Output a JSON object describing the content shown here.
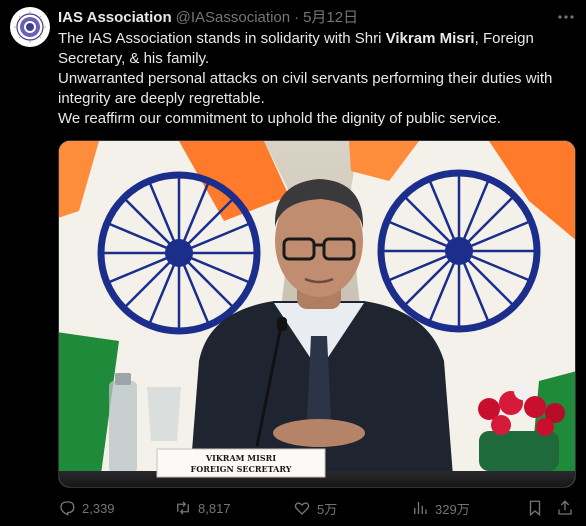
{
  "tweet": {
    "display_name": "IAS Association",
    "handle": "@IASassociation",
    "separator": "·",
    "date": "5月12日",
    "text": {
      "line1_prefix": "The IAS Association stands in solidarity with Shri ",
      "line1_bold": "Vikram Misri",
      "line1_suffix": ", Foreign Secretary, & his family.",
      "line2": "Unwarranted personal attacks on civil servants performing their duties with integrity are deeply regrettable.",
      "line3": "We reaffirm our commitment to uphold the dignity of public service."
    },
    "media": {
      "nameplate_line1": "VIKRAM MISRI",
      "nameplate_line2": "FOREIGN SECRETARY"
    },
    "actions": {
      "replies": "2,339",
      "reposts": "8,817",
      "likes": "5万",
      "views": "329万"
    },
    "icons": {
      "avatar": "ias-logo-icon",
      "more": "more-dots-icon",
      "reply": "reply-icon",
      "repost": "repost-icon",
      "like": "heart-icon",
      "views": "views-chart-icon",
      "bookmark": "bookmark-icon",
      "share": "share-icon"
    },
    "colors": {
      "background": "#000000",
      "text": "#e7e9ea",
      "secondary": "#71767b",
      "saffron": "#ff7a2a",
      "green": "#1f8a3a",
      "chakra_blue": "#1b2e8c"
    }
  }
}
